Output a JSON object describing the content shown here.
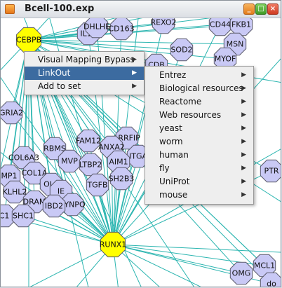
{
  "window": {
    "title": "Bcell-100.exp",
    "minimize_label": "_",
    "maximize_label": "□",
    "close_label": "×"
  },
  "colors": {
    "edge": "#2bb5b0",
    "node_fill": "#c9c9f5",
    "node_stroke": "#5a5a6a",
    "highlight_fill": "#ffff00",
    "menu_highlight": "#3c6ba0"
  },
  "network": {
    "nodes": [
      {
        "label": "CEBPB",
        "highlight": true
      },
      {
        "label": "RUNX1",
        "highlight": true
      },
      {
        "label": "IL13",
        "highlight": false
      },
      {
        "label": "DHLHE",
        "highlight": false
      },
      {
        "label": "CD163",
        "highlight": false
      },
      {
        "label": "REXO2",
        "highlight": false
      },
      {
        "label": "CD44",
        "highlight": false
      },
      {
        "label": "FKB1",
        "highlight": false
      },
      {
        "label": "MSN",
        "highlight": false
      },
      {
        "label": "SOD2",
        "highlight": false
      },
      {
        "label": "MYOF",
        "highlight": false
      },
      {
        "label": "CDB",
        "highlight": false
      },
      {
        "label": "GRIA2",
        "highlight": false
      },
      {
        "label": "FAM12",
        "highlight": false
      },
      {
        "label": "LRRFIP",
        "highlight": false
      },
      {
        "label": "RBMS",
        "highlight": false
      },
      {
        "label": "ANXA2",
        "highlight": false
      },
      {
        "label": "ITGA",
        "highlight": false
      },
      {
        "label": "COL6A3",
        "highlight": false
      },
      {
        "label": "MVP",
        "highlight": false
      },
      {
        "label": "LTBP2",
        "highlight": false
      },
      {
        "label": "AIM1",
        "highlight": false
      },
      {
        "label": "COL1A",
        "highlight": false
      },
      {
        "label": "MP1",
        "highlight": false
      },
      {
        "label": "OL1",
        "highlight": false
      },
      {
        "label": "IE",
        "highlight": false
      },
      {
        "label": "TGFB",
        "highlight": false
      },
      {
        "label": "SH2B3",
        "highlight": false
      },
      {
        "label": "KLHL2",
        "highlight": false
      },
      {
        "label": "SYNPO",
        "highlight": false
      },
      {
        "label": "DRAM",
        "highlight": false
      },
      {
        "label": "C1",
        "highlight": false
      },
      {
        "label": "SHC1",
        "highlight": false
      },
      {
        "label": "IBD2",
        "highlight": false
      },
      {
        "label": "PTR",
        "highlight": false
      },
      {
        "label": "OMG",
        "highlight": false
      },
      {
        "label": "MCL1",
        "highlight": false
      },
      {
        "label": "do",
        "highlight": false
      }
    ]
  },
  "context_menu": {
    "items": [
      {
        "label": "Visual Mapping Bypass",
        "has_submenu": true
      },
      {
        "label": "LinkOut",
        "has_submenu": true,
        "active": true
      },
      {
        "label": "Add to set",
        "has_submenu": true
      }
    ]
  },
  "linkout_submenu": {
    "items": [
      {
        "label": "Entrez"
      },
      {
        "label": "Biological resources"
      },
      {
        "label": "Reactome"
      },
      {
        "label": "Web resources"
      },
      {
        "label": "yeast"
      },
      {
        "label": "worm"
      },
      {
        "label": "human"
      },
      {
        "label": "fly"
      },
      {
        "label": "UniProt"
      },
      {
        "label": "mouse"
      }
    ],
    "arrow_glyph": "▶"
  }
}
